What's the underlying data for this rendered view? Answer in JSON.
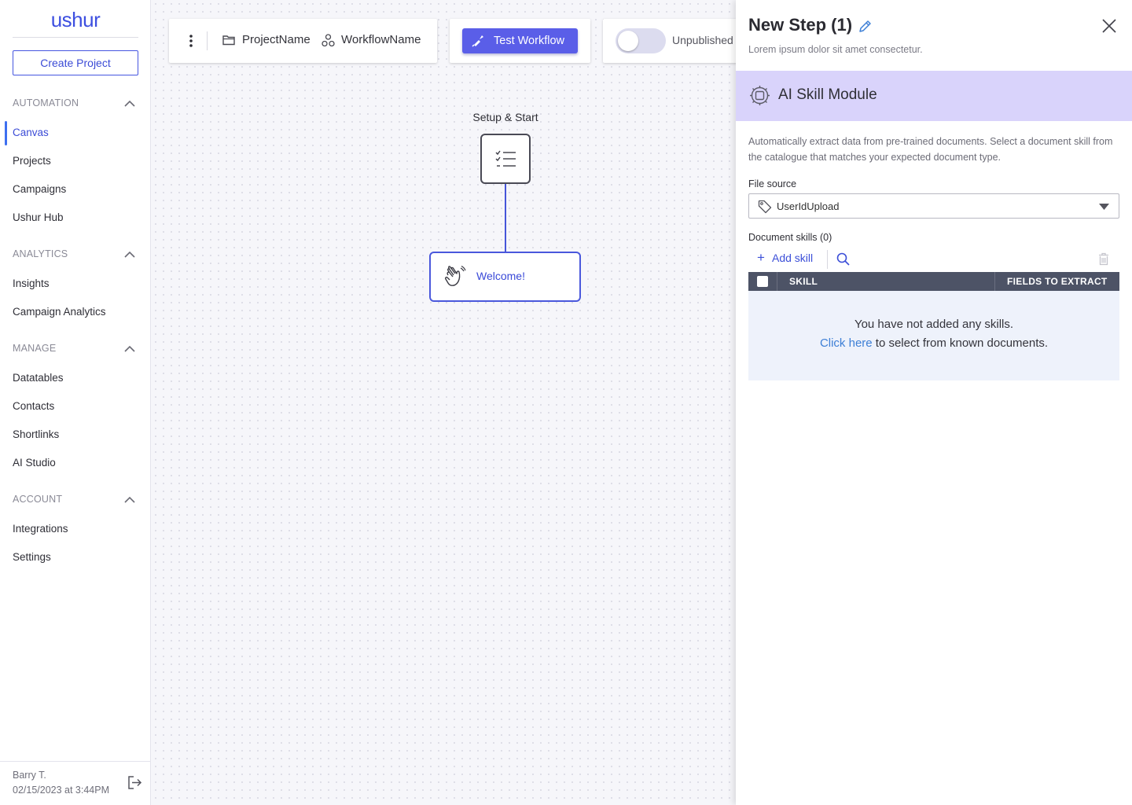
{
  "sidebar": {
    "logo": "ushur",
    "create_button": "Create Project",
    "sections": {
      "automation": {
        "title": "AUTOMATION",
        "items": [
          "Canvas",
          "Projects",
          "Campaigns",
          "Ushur Hub"
        ]
      },
      "analytics": {
        "title": "ANALYTICS",
        "items": [
          "Insights",
          "Campaign Analytics"
        ]
      },
      "manage": {
        "title": "MANAGE",
        "items": [
          "Datatables",
          "Contacts",
          "Shortlinks",
          "AI Studio"
        ]
      },
      "account": {
        "title": "ACCOUNT",
        "items": [
          "Integrations",
          "Settings"
        ]
      }
    },
    "active_item": "Canvas",
    "user": {
      "name": "Barry T.",
      "timestamp": "02/15/2023 at 3:44PM"
    }
  },
  "toolbar": {
    "project_name": "ProjectName",
    "workflow_name": "WorkflowName",
    "test_button": "Test Workflow",
    "publish_status": "Unpublished",
    "published": false
  },
  "canvas": {
    "start_node_label": "Setup & Start",
    "welcome_node_label": "Welcome!"
  },
  "panel": {
    "title": "New Step (1)",
    "subtitle": "Lorem ipsum dolor sit amet consectetur.",
    "module_title": "AI Skill Module",
    "description": "Automatically extract data from pre-trained documents. Select a document skill from the catalogue that matches your expected document type.",
    "file_source_label": "File source",
    "file_source_value": "UserIdUpload",
    "document_skills_label": "Document skills (0)",
    "add_skill": "Add skill",
    "columns": {
      "skill": "SKILL",
      "fields": "FIELDS TO EXTRACT"
    },
    "empty_message": "You have not added any skills.",
    "empty_link": "Click here",
    "empty_suffix": " to select from known documents."
  },
  "colors": {
    "accent": "#4a58dc",
    "module_band": "#d9d3fb",
    "table_header": "#4d5366",
    "empty_bg": "#eef2fb"
  },
  "icons": [
    "kebab-icon",
    "folder-icon",
    "workflow-icon",
    "brush-icon",
    "checklist-icon",
    "wave-icon",
    "pencil-icon",
    "close-icon",
    "chip-icon",
    "tag-icon",
    "caret-down-icon",
    "search-icon",
    "trash-icon",
    "logout-icon",
    "chevron-up-icon"
  ]
}
